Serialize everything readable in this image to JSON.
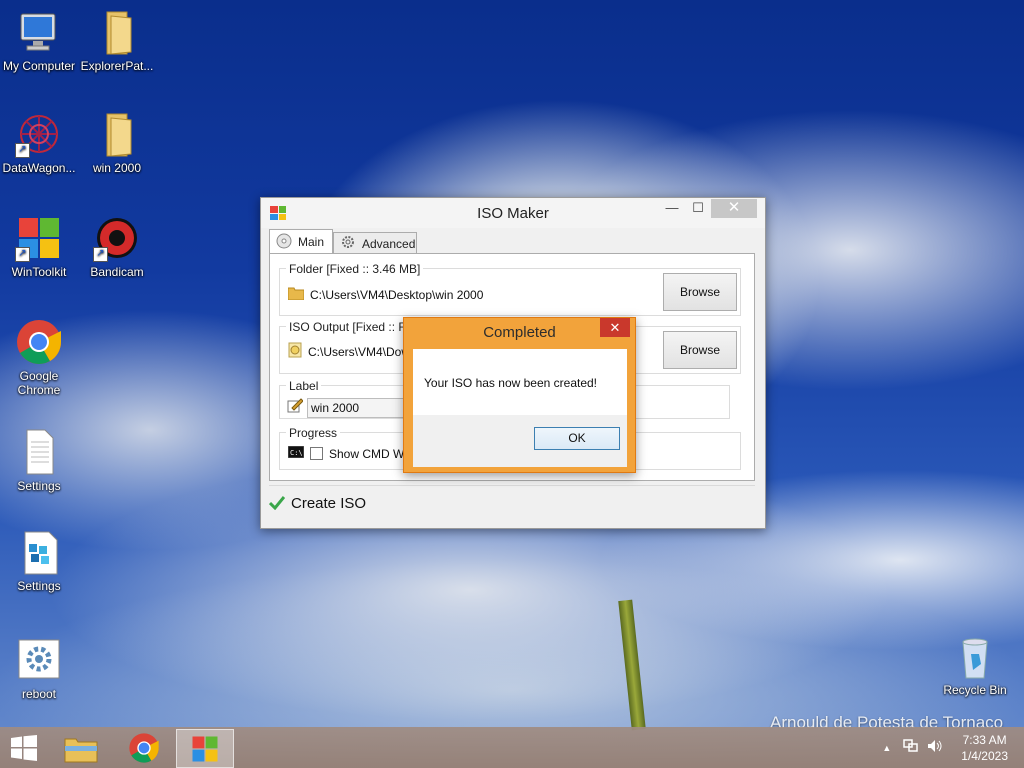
{
  "desktop": {
    "icons": [
      {
        "label": "My Computer",
        "icon": "computer-icon"
      },
      {
        "label": "ExplorerPat...",
        "icon": "folder-icon"
      },
      {
        "label": "DataWagon...",
        "icon": "datawagon-icon"
      },
      {
        "label": "win 2000",
        "icon": "folder-icon"
      },
      {
        "label": "WinToolkit",
        "icon": "wintoolkit-icon"
      },
      {
        "label": "Bandicam",
        "icon": "bandicam-icon"
      },
      {
        "label": "Google Chrome",
        "icon": "chrome-icon"
      },
      {
        "label": "Settings",
        "icon": "text-file-icon"
      },
      {
        "label": "Settings",
        "icon": "registry-icon"
      },
      {
        "label": "reboot",
        "icon": "reboot-icon"
      },
      {
        "label": "Recycle Bin",
        "icon": "recycle-bin-icon"
      }
    ],
    "watermark": "Arnould de Potesta de Tornaco"
  },
  "iso_window": {
    "title": "ISO Maker",
    "tabs": [
      {
        "label": "Main"
      },
      {
        "label": "Advanced"
      }
    ],
    "folder_group": {
      "label": "Folder [Fixed :: 3.46 MB]",
      "path": "C:\\Users\\VM4\\Desktop\\win 2000",
      "browse": "Browse"
    },
    "output_group": {
      "label": "ISO Output [Fixed :: Free",
      "path": "C:\\Users\\VM4\\Dow",
      "browse": "Browse"
    },
    "label_group": {
      "label": "Label",
      "value": "win 2000"
    },
    "progress_group": {
      "label": "Progress",
      "checkbox_label": "Show CMD Wir"
    },
    "create_button": "Create ISO"
  },
  "dialog": {
    "title": "Completed",
    "message": "Your ISO has now been created!",
    "ok": "OK",
    "close_glyph": "✕"
  },
  "taskbar": {
    "time": "7:33 AM",
    "date": "1/4/2023"
  }
}
